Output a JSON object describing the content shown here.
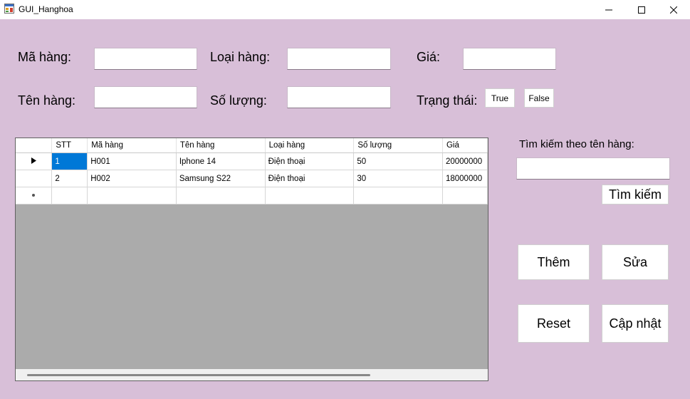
{
  "window": {
    "title": "GUI_Hanghoa"
  },
  "form": {
    "ma_hang_label": "Mã hàng:",
    "loai_hang_label": "Loại hàng:",
    "gia_label": "Giá:",
    "ten_hang_label": "Tên hàng:",
    "so_luong_label": "Số lượng:",
    "trang_thai_label": "Trạng thái:",
    "ma_hang_value": "",
    "loai_hang_value": "",
    "gia_value": "",
    "ten_hang_value": "",
    "so_luong_value": "",
    "true_label": "True",
    "false_label": "False"
  },
  "search": {
    "label": "Tìm kiếm theo tên hàng:",
    "value": "",
    "button_label": "Tìm kiếm"
  },
  "actions": {
    "add_label": "Thêm",
    "edit_label": "Sửa",
    "reset_label": "Reset",
    "update_label": "Cập nhật"
  },
  "grid": {
    "columns": [
      "STT",
      "Mã hàng",
      "Tên hàng",
      "Loại hàng",
      "Số lượng",
      "Giá"
    ],
    "rows": [
      [
        "1",
        "H001",
        "Iphone 14",
        "Điện thoại",
        "50",
        "20000000"
      ],
      [
        "2",
        "H002",
        "Samsung S22",
        "Điện thoại",
        "30",
        "18000000"
      ]
    ]
  },
  "colors": {
    "form_background": "#d8bfd8",
    "grid_background": "#ababab",
    "selection": "#0078d7"
  }
}
